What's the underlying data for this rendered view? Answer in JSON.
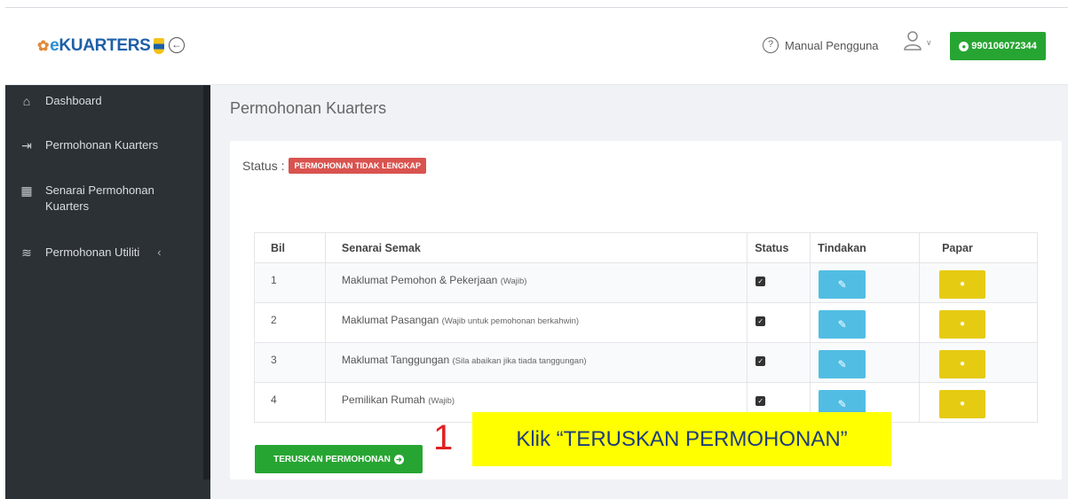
{
  "header": {
    "logo_text": "eKUARTERS",
    "manual_label": "Manual Pengguna",
    "user_id": "990106072344"
  },
  "sidebar": {
    "items": [
      {
        "label": "Dashboard",
        "icon": "home-icon"
      },
      {
        "label": "Permohonan Kuarters",
        "icon": "sign-in-icon"
      },
      {
        "label": "Senarai Permohonan Kuarters",
        "icon": "building-icon"
      },
      {
        "label": "Permohonan Utiliti",
        "icon": "layers-icon"
      }
    ]
  },
  "main": {
    "title": "Permohonan Kuarters",
    "status_label": "Status :",
    "status_value": "PERMOHONAN TIDAK LENGKAP",
    "table": {
      "headers": [
        "Bil",
        "Senarai Semak",
        "Status",
        "Tindakan",
        "Papar"
      ],
      "rows": [
        {
          "bil": "1",
          "item": "Maklumat Pemohon & Pekerjaan",
          "note": "(Wajib)",
          "checked": true
        },
        {
          "bil": "2",
          "item": "Maklumat Pasangan",
          "note": "(Wajib untuk pemohonan berkahwin)",
          "checked": true
        },
        {
          "bil": "3",
          "item": "Maklumat Tanggungan",
          "note": "(Sila abaikan jika tiada tanggungan)",
          "checked": true
        },
        {
          "bil": "4",
          "item": "Pemilikan Rumah",
          "note": "(Wajib)",
          "checked": true
        }
      ]
    },
    "submit_label": "TERUSKAN PERMOHONAN"
  },
  "annotation": {
    "step_number": "1",
    "instruction": "Klik “TERUSKAN PERMOHONAN”"
  },
  "colors": {
    "sidebar_bg": "#2c3136",
    "green": "#27a532",
    "edit_blue": "#52bde3",
    "view_yellow": "#e6cb13",
    "status_red": "#d9534f",
    "annotation_yellow": "#ffff00",
    "annotation_red": "#e02020"
  }
}
